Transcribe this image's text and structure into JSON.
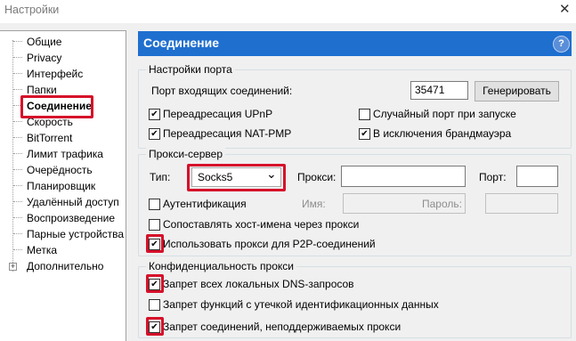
{
  "window": {
    "title": "Настройки",
    "close_glyph": "✕"
  },
  "sidebar": {
    "items": [
      {
        "label": "Общие"
      },
      {
        "label": "Privacy"
      },
      {
        "label": "Интерфейс"
      },
      {
        "label": "Папки"
      },
      {
        "label": "Соединение"
      },
      {
        "label": "Скорость"
      },
      {
        "label": "BitTorrent"
      },
      {
        "label": "Лимит трафика"
      },
      {
        "label": "Очерёдность"
      },
      {
        "label": "Планировщик"
      },
      {
        "label": "Удалённый доступ"
      },
      {
        "label": "Воспроизведение"
      },
      {
        "label": "Парные устройства"
      },
      {
        "label": "Метка"
      },
      {
        "label": "Дополнительно"
      }
    ],
    "selected_index": 4,
    "expander_glyph": "+"
  },
  "header": {
    "title": "Соединение",
    "help_glyph": "?",
    "accent": "#1f6fcf"
  },
  "highlight_color": "#d6102a",
  "port_settings": {
    "legend": "Настройки порта",
    "incoming_port_label": "Порт входящих соединений:",
    "incoming_port_value": "35471",
    "generate_button": "Генерировать",
    "upnp_label": "Переадресация UPnP",
    "upnp_checked": true,
    "random_port_label": "Случайный порт при запуске",
    "random_port_checked": false,
    "natpmp_label": "Переадресация NAT-PMP",
    "natpmp_checked": true,
    "firewall_label": "В исключения брандмауэра",
    "firewall_checked": true
  },
  "proxy_server": {
    "legend": "Прокси-сервер",
    "type_label": "Тип:",
    "type_value": "Socks5",
    "proxy_label": "Прокси:",
    "proxy_value": "",
    "port_label": "Порт:",
    "port_value": "",
    "auth_label": "Аутентификация",
    "auth_checked": false,
    "name_label": "Имя:",
    "password_label": "Пароль:",
    "resolve_label": "Сопоставлять хост-имена через прокси",
    "resolve_checked": false,
    "p2p_label": "Использовать прокси для P2P-соединений",
    "p2p_checked": true
  },
  "privacy": {
    "legend": "Конфиденциальность прокси",
    "dns_label": "Запрет всех локальных DNS-запросов",
    "dns_checked": true,
    "leak_label": "Запрет функций с утечкой идентификационных данных",
    "leak_checked": false,
    "unsupported_label": "Запрет соединений, неподдерживаемых прокси",
    "unsupported_checked": true
  },
  "check_glyph": "✔",
  "dropdown_glyph": "⌄"
}
